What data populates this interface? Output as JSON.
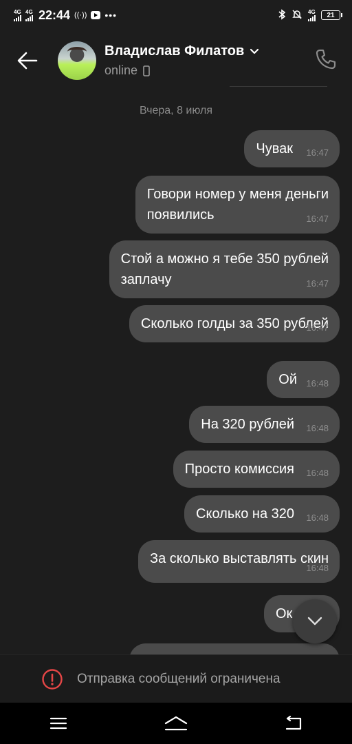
{
  "status_bar": {
    "net1": "4G",
    "net2": "4G",
    "time": "22:44",
    "hotspot": "((·))",
    "dots": "•••",
    "net3": "4G",
    "battery": "21"
  },
  "header": {
    "contact_name": "Владислав Филатов",
    "status": "online"
  },
  "chat": {
    "date": "Вчера, 8 июля",
    "messages": [
      {
        "text": "Чувак",
        "time": "16:47"
      },
      {
        "text": "Говори номер у меня деньги\nпоявились",
        "time": "16:47"
      },
      {
        "text": "Стой а можно я тебе 350 рублей\nзаплачу",
        "time": "16:47"
      },
      {
        "text": "Сколько голды за 350 рублей",
        "time": "16:47"
      },
      {
        "text": "Ой",
        "time": "16:48"
      },
      {
        "text": "На 320 рублей",
        "time": "16:48"
      },
      {
        "text": "Просто комиссия",
        "time": "16:48"
      },
      {
        "text": "Сколько на 320",
        "time": "16:48"
      },
      {
        "text": "За сколько выставлять скин",
        "time": "16:48"
      },
      {
        "text": "Ок",
        "time": ""
      }
    ]
  },
  "restriction": {
    "text": "Отправка сообщений ограничена"
  },
  "colors": {
    "background": "#1d1d1d",
    "bubble": "#4b4b4b",
    "warning": "#e64646"
  }
}
